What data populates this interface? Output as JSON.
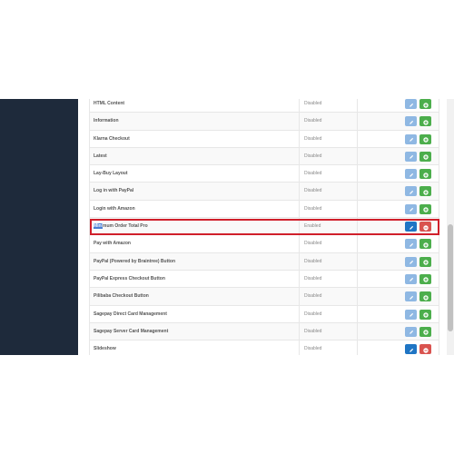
{
  "modules": [
    {
      "name": "HTML Content",
      "status": "Disabled",
      "action": "install"
    },
    {
      "name": "Information",
      "status": "Disabled",
      "action": "install"
    },
    {
      "name": "Klarna Checkout",
      "status": "Disabled",
      "action": "install"
    },
    {
      "name": "Latest",
      "status": "Disabled",
      "action": "install"
    },
    {
      "name": "Lay-Buy Layout",
      "status": "Disabled",
      "action": "install"
    },
    {
      "name": "Log in with PayPal",
      "status": "Disabled",
      "action": "install"
    },
    {
      "name": "Login with Amazon",
      "status": "Disabled",
      "action": "install"
    },
    {
      "name_selected": "Mini",
      "name_rest": "mum Order Total Pro",
      "status": "Enabled",
      "action": "uninstall",
      "highlighted": true
    },
    {
      "name": "Pay with Amazon",
      "status": "Disabled",
      "action": "install"
    },
    {
      "name": "PayPal (Powered by Braintree) Button",
      "status": "Disabled",
      "action": "install"
    },
    {
      "name": "PayPal Express Checkout Button",
      "status": "Disabled",
      "action": "install"
    },
    {
      "name": "Pilibaba Checkout Button",
      "status": "Disabled",
      "action": "install"
    },
    {
      "name": "Sagepay Direct Card Management",
      "status": "Disabled",
      "action": "install"
    },
    {
      "name": "Sagepay Server Card Management",
      "status": "Disabled",
      "action": "install"
    },
    {
      "name": "Slideshow",
      "status": "Disabled",
      "action": "uninstall"
    }
  ],
  "icons": {
    "edit": "pencil-icon",
    "install": "plus-circle-icon",
    "uninstall": "minus-circle-icon"
  },
  "colors": {
    "sidebar": "#1e2a3b",
    "edit_button": "#8fb8e3",
    "edit_button_active": "#1f75c4",
    "install_button": "#4cae4c",
    "uninstall_button": "#d9534f",
    "highlight_box": "#d01f2a"
  }
}
